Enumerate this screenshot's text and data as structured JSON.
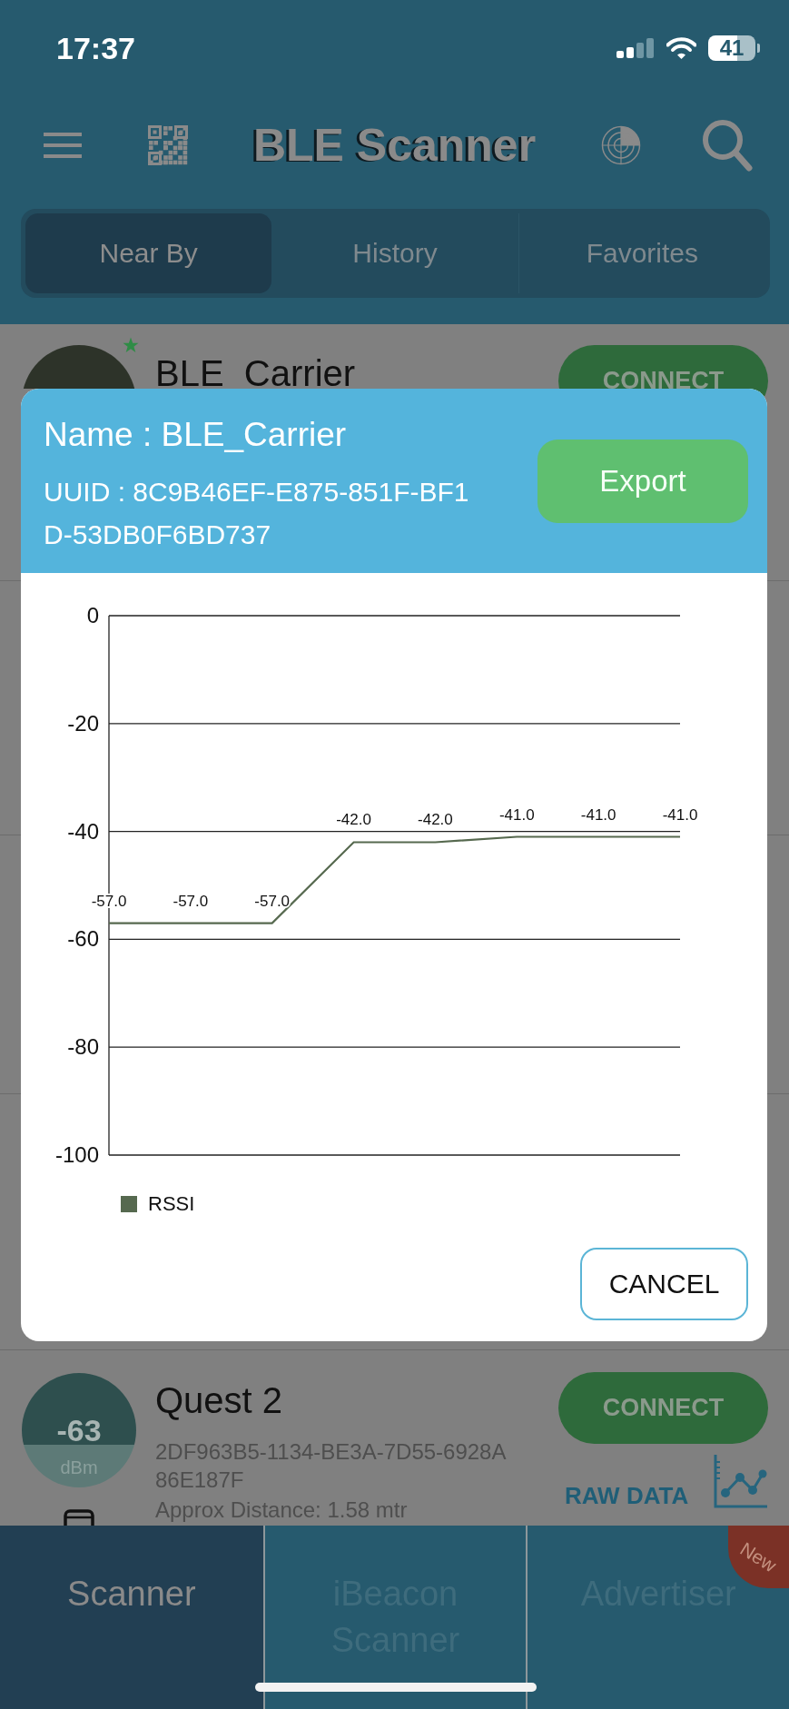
{
  "status_bar": {
    "time": "17:37",
    "battery": "41"
  },
  "app_bar": {
    "title": "BLE Scanner"
  },
  "tabs": [
    {
      "label": "Near By",
      "selected": true
    },
    {
      "label": "History",
      "selected": false
    },
    {
      "label": "Favorites",
      "selected": false
    }
  ],
  "device_behind_dialog": {
    "name": "BLE_Carrier",
    "favorite": true,
    "button": "CONNECT"
  },
  "device_below_dialog": {
    "rssi": "-63",
    "unit": "dBm",
    "name": "Quest 2",
    "uuid_lines": [
      "2DF963B5-1134-BE3A-7D55-6928A",
      "86E187F"
    ],
    "distance": "Approx Distance: 1.58 mtr",
    "button": "CONNECT",
    "raw_data": "RAW DATA"
  },
  "dialog": {
    "name": "Name : BLE_Carrier",
    "uuid_lines": [
      "UUID : 8C9B46EF-E875-851F-BF1",
      "D-53DB0F6BD737"
    ],
    "export_button": "Export",
    "chart": {
      "chart_data": {
        "type": "line",
        "grid": true,
        "series": [
          {
            "name": "RSSI",
            "color": "#56694f",
            "values": [
              -57,
              -57,
              -57,
              -42,
              -42,
              -41,
              -41,
              -41
            ]
          }
        ],
        "ylim": [
          -100,
          0
        ],
        "yticks": [
          0,
          -20,
          -40,
          -60,
          -80,
          -100
        ],
        "value_labels": [
          "-57.0",
          "-57.0",
          "-57.0",
          "-42.0",
          "-42.0",
          "-41.0",
          "-41.0",
          "-41.0"
        ]
      }
    },
    "cancel_button": "CANCEL"
  },
  "bottom_tabs": [
    {
      "label": "Scanner",
      "selected": true
    },
    {
      "label": "iBeacon Scanner",
      "selected": false
    },
    {
      "label": "Advertiser",
      "selected": false,
      "badge": "New"
    }
  ]
}
